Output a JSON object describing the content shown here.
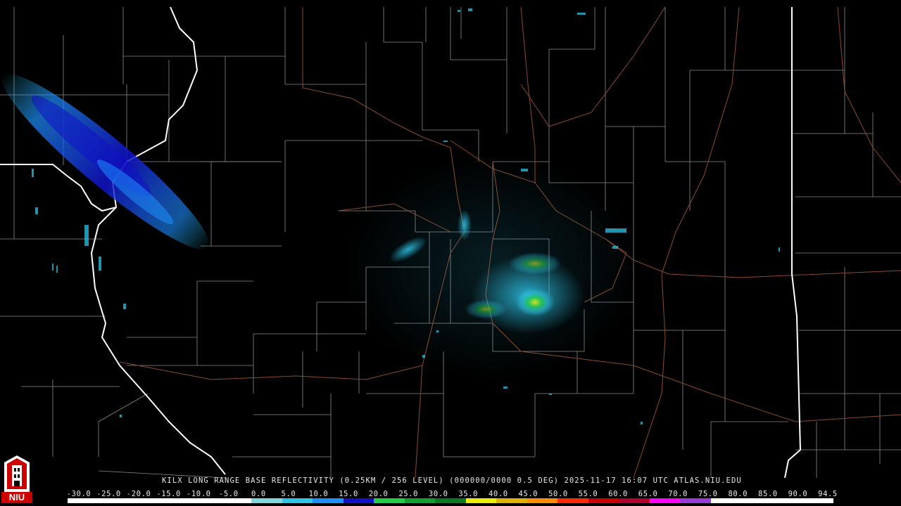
{
  "caption": "KILX LONG RANGE BASE REFLECTIVITY (0.25KM / 256 LEVEL) (000000/0000 0.5 DEG) 2025-11-17 16:07 UTC  ATLAS.NIU.EDU",
  "logo": {
    "text": "NIU",
    "icon": "niu-tower-logo-icon"
  },
  "colorbar": {
    "ticks": [
      "-30.0",
      "-25.0",
      "-20.0",
      "-15.0",
      "-10.0",
      "-5.0",
      "0.0",
      "5.0",
      "10.0",
      "15.0",
      "20.0",
      "25.0",
      "30.0",
      "35.0",
      "40.0",
      "45.0",
      "50.0",
      "55.0",
      "60.0",
      "65.0",
      "70.0",
      "75.0",
      "80.0",
      "85.0",
      "90.0",
      "94.5"
    ],
    "colors": [
      "#ffffff",
      "#ffffff",
      "#ffffff",
      "#ffffff",
      "#ffffff",
      "#ffffff",
      "#7fd8dc",
      "#2ec4e6",
      "#1e90ff",
      "#1010c8",
      "#22cc44",
      "#11a030",
      "#0a7a22",
      "#eded00",
      "#e0b000",
      "#ff8c00",
      "#ff2a00",
      "#cc0000",
      "#b00030",
      "#ff00ff",
      "#9a3dd8",
      "#ffffff",
      "#ffffff",
      "#ffffff",
      "#ffffff"
    ]
  },
  "map": {
    "colors": {
      "county": "#8a8a8a",
      "state": "#ffffff",
      "highway": "#8b4a2c"
    },
    "radar_site": "KILX"
  }
}
